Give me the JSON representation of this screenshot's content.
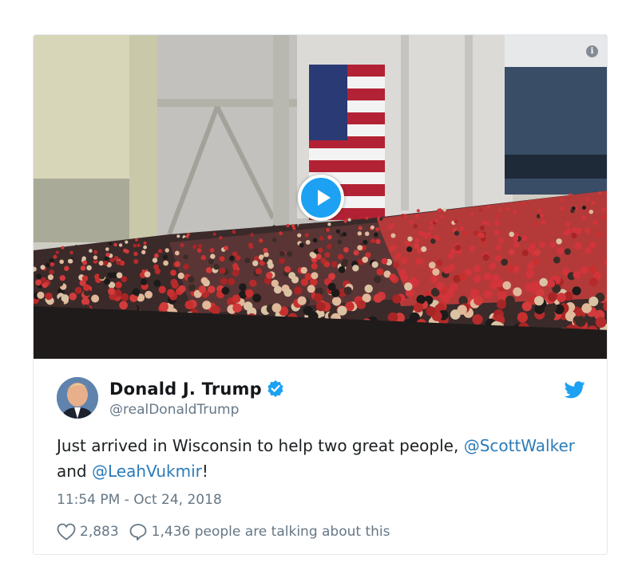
{
  "media": {
    "info_label": "i",
    "play_label": "play-video"
  },
  "author": {
    "display_name": "Donald J. Trump",
    "handle": "@realDonaldTrump",
    "verified": true
  },
  "tweet": {
    "text_before": "Just arrived in Wisconsin to help two great people, ",
    "mention_1": "@ScottWalker",
    "text_middle": " and ",
    "mention_2": "@LeahVukmir",
    "text_after": "!",
    "timestamp": "11:54 PM - Oct 24, 2018"
  },
  "stats": {
    "likes": "2,883",
    "replies_text": "1,436 people are talking about this"
  },
  "colors": {
    "twitter_blue": "#1da1f2",
    "link_blue": "#2b7bb9",
    "meta_gray": "#657786",
    "border": "#e1e8ed"
  },
  "icons": [
    "info-icon",
    "play-icon",
    "verified-badge-icon",
    "twitter-bird-icon",
    "heart-icon",
    "comment-icon"
  ]
}
